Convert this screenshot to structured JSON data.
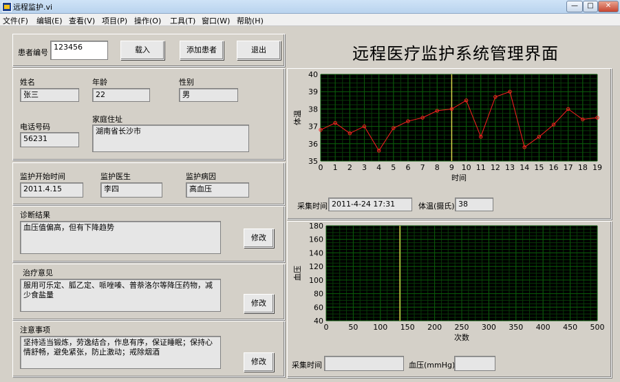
{
  "window": {
    "title": "远程监护.vi",
    "btn_min": "—",
    "btn_max": "□",
    "btn_close": "✕"
  },
  "menu": [
    "文件(F)",
    "编辑(E)",
    "查看(V)",
    "项目(P)",
    "操作(O)",
    "工具(T)",
    "窗口(W)",
    "帮助(H)"
  ],
  "header": {
    "patient_id_label": "患者编号",
    "patient_id_value": "123456",
    "load_button": "载入",
    "add_patient_button": "添加患者",
    "exit_button": "退出",
    "system_title": "远程医疗监护系统管理界面"
  },
  "patient": {
    "name_label": "姓名",
    "name": "张三",
    "age_label": "年龄",
    "age": "22",
    "gender_label": "性别",
    "gender": "男",
    "phone_label": "电话号码",
    "phone": "56231",
    "address_label": "家庭住址",
    "address": "湖南省长沙市"
  },
  "monitor": {
    "start_label": "监护开始时间",
    "start": "2011.4.15",
    "doctor_label": "监护医生",
    "doctor": "李四",
    "disease_label": "监护病因",
    "disease": "高血压"
  },
  "diagnosis": {
    "label": "诊断结果",
    "text": "血压值偏高，但有下降趋势",
    "modify": "修改"
  },
  "treatment": {
    "label": "治疗意见",
    "text": "服用可乐定、胍乙定、哌唑嗪、普萘洛尔等降压药物，减少食盐量",
    "modify": "修改"
  },
  "notes": {
    "label": "注意事项",
    "text": "坚持适当锻炼，劳逸结合，作息有序，保证睡眠；保持心情舒畅，避免紧张，防止激动；戒除烟酒",
    "modify": "修改"
  },
  "temp_readout": {
    "time_label": "采集时间",
    "time": "2011-4-24 17:31",
    "temp_label": "体温(摄氏)",
    "temp": "38"
  },
  "bp_readout": {
    "time_label": "采集时间",
    "time": "",
    "bp_label": "血压(mmHg)",
    "bp": ""
  },
  "colors": {
    "plot_bg": "#000000",
    "grid": "#0a5a0a",
    "trace": "#ff2020",
    "cursor": "#d8d04a"
  },
  "chart_data": [
    {
      "type": "line",
      "name": "temperature",
      "xlabel": "时间",
      "ylabel": "体温",
      "xlim": [
        0,
        19
      ],
      "ylim": [
        35,
        40
      ],
      "x_ticks": [
        0,
        1,
        2,
        3,
        4,
        5,
        6,
        7,
        8,
        9,
        10,
        11,
        12,
        13,
        14,
        15,
        16,
        17,
        18,
        19
      ],
      "y_ticks": [
        35,
        36,
        37,
        38,
        39,
        40
      ],
      "x": [
        0,
        1,
        2,
        3,
        4,
        5,
        6,
        7,
        8,
        9,
        10,
        11,
        12,
        13,
        14,
        15,
        16,
        17,
        18,
        19
      ],
      "values": [
        36.8,
        37.2,
        36.6,
        37.0,
        35.6,
        36.9,
        37.3,
        37.5,
        37.9,
        38.0,
        38.5,
        36.4,
        38.7,
        39.0,
        35.8,
        36.4,
        37.1,
        38.0,
        37.4,
        37.5
      ],
      "cursor_x": 9,
      "grid": true
    },
    {
      "type": "line",
      "name": "blood-pressure",
      "xlabel": "次数",
      "ylabel": "血压",
      "xlim": [
        0,
        500
      ],
      "ylim": [
        40,
        180
      ],
      "x_ticks": [
        0,
        50,
        100,
        150,
        200,
        250,
        300,
        350,
        400,
        450,
        500
      ],
      "y_ticks": [
        40,
        60,
        80,
        100,
        120,
        140,
        160,
        180
      ],
      "x": [],
      "values": [],
      "cursor_x": 136,
      "grid": true
    }
  ]
}
